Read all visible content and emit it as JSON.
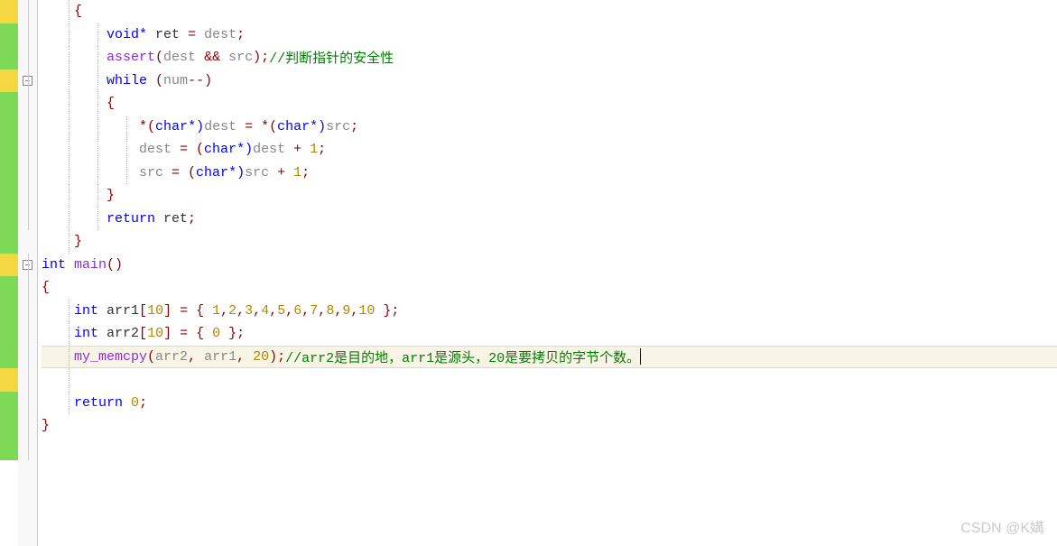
{
  "margins": [
    "yellow",
    "green",
    "green",
    "yellow",
    "green",
    "green",
    "green",
    "green",
    "green",
    "green",
    "green",
    "yellow",
    "green",
    "green",
    "green",
    "green",
    "yellow",
    "green",
    "green",
    "green"
  ],
  "folds": [
    "line",
    "line",
    "line",
    "box",
    "line",
    "line",
    "line",
    "line",
    "line",
    "line",
    "",
    "box",
    "line",
    "line",
    "line",
    "line",
    "line",
    "line",
    "line",
    "line"
  ],
  "code": {
    "l0": "    {",
    "l1a": "        ",
    "l1b": "void",
    "l1c": "*",
    "l1d": " ret ",
    "l1e": "=",
    "l1f": " dest",
    "l1g": ";",
    "l2a": "        assert",
    "l2b": "(",
    "l2c": "dest ",
    "l2d": "&&",
    "l2e": " src",
    "l2f": ");",
    "l2g": "//判断指针的安全性",
    "l3a": "        ",
    "l3b": "while",
    "l3c": " (",
    "l3d": "num",
    "l3e": "--)",
    "l4": "        {",
    "l5a": "            ",
    "l5b": "*(",
    "l5c": "char",
    "l5d": "*)",
    "l5e": "dest ",
    "l5f": "= *(",
    "l5g": "char",
    "l5h": "*)",
    "l5i": "src",
    "l5j": ";",
    "l6a": "            dest ",
    "l6b": "= (",
    "l6c": "char",
    "l6d": "*)",
    "l6e": "dest ",
    "l6f": "+ ",
    "l6g": "1",
    "l6h": ";",
    "l7a": "            src ",
    "l7b": "= (",
    "l7c": "char",
    "l7d": "*)",
    "l7e": "src ",
    "l7f": "+ ",
    "l7g": "1",
    "l7h": ";",
    "l8": "        }",
    "l9a": "        ",
    "l9b": "return",
    "l9c": " ret",
    "l9d": ";",
    "l10": "    }",
    "l11a": "int",
    "l11b": " main",
    "l11c": "()",
    "l12": "{",
    "l13a": "    ",
    "l13b": "int",
    "l13c": " arr1",
    "l13d": "[",
    "l13e": "10",
    "l13f": "] = { ",
    "l13g": "1",
    "l13h": ",",
    "l13i": "2",
    "l13j": ",",
    "l13k": "3",
    "l13l": ",",
    "l13m": "4",
    "l13n": ",",
    "l13o": "5",
    "l13p": ",",
    "l13q": "6",
    "l13r": ",",
    "l13s": "7",
    "l13t": ",",
    "l13u": "8",
    "l13v": ",",
    "l13w": "9",
    "l13x": ",",
    "l13y": "10",
    "l13z": " };",
    "l14a": "    ",
    "l14b": "int",
    "l14c": " arr2",
    "l14d": "[",
    "l14e": "10",
    "l14f": "] = { ",
    "l14g": "0",
    "l14h": " };",
    "l15a": "    my_memcpy",
    "l15b": "(",
    "l15c": "arr2",
    "l15d": ", ",
    "l15e": "arr1",
    "l15f": ", ",
    "l15g": "20",
    "l15h": ");",
    "l15i": "//arr2是目的地，arr1是源头，20是要拷贝的字节个数。",
    "l16": "",
    "l17a": "    ",
    "l17b": "return",
    "l17c": " ",
    "l17d": "0",
    "l17e": ";",
    "l18": "}"
  },
  "watermark": "CSDN @K媾"
}
